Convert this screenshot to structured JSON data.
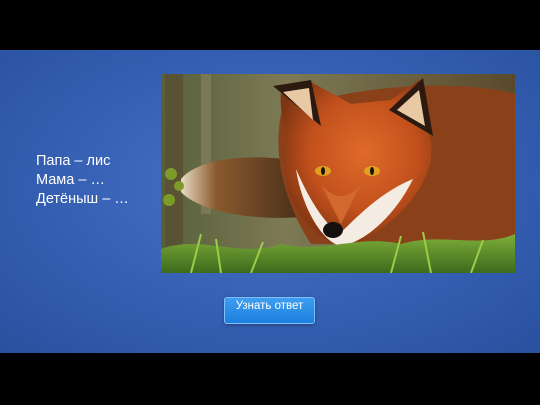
{
  "slide": {
    "lines": [
      "Папа – лис",
      "Мама – …",
      "Детёныш – …"
    ],
    "answer_button_label": "Узнать ответ"
  },
  "image": {
    "subject": "red fox in grass",
    "icon": "fox-photo"
  },
  "colors": {
    "frame": "#000000",
    "slide_background": "#3762b6",
    "button": "#2a8be8",
    "text": "#ffffff"
  }
}
